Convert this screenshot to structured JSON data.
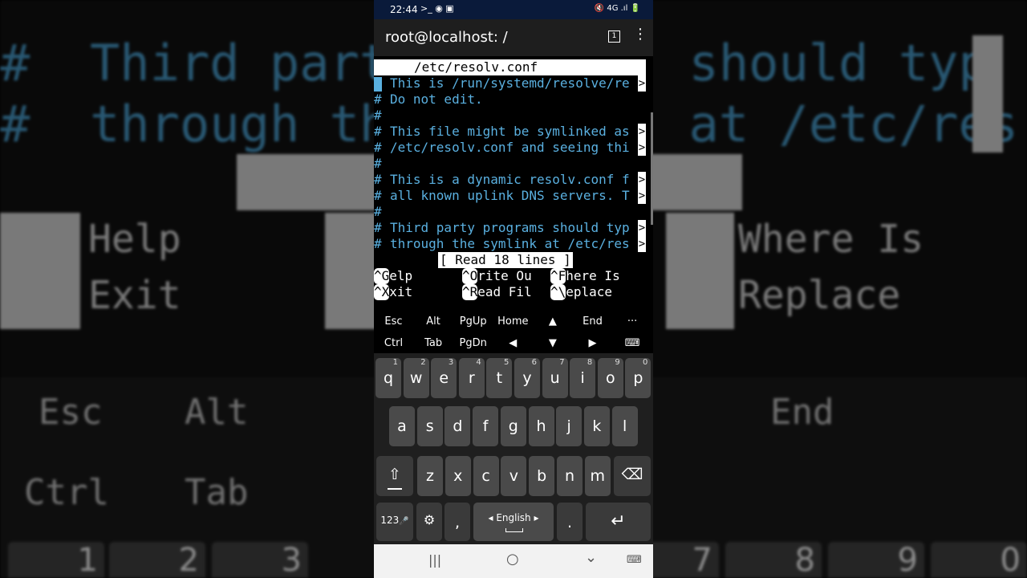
{
  "status_bar": {
    "time": "22:44",
    "left_icons": ">_ ◉ ▣",
    "right_icons": "🔇 4G .ıl 🔋"
  },
  "app_bar": {
    "title": "root@localhost: /",
    "window_count": "1",
    "menu_icon": "⋮"
  },
  "editor": {
    "file_title": "/etc/resolv.conf",
    "lines": [
      {
        "hash": "#",
        "text": "This is /run/systemd/resolve/re",
        "more": true
      },
      {
        "hash": "#",
        "text": "Do not edit.",
        "more": false
      },
      {
        "hash": "#",
        "text": "",
        "more": false
      },
      {
        "hash": "#",
        "text": "This file might be symlinked as",
        "more": true
      },
      {
        "hash": "#",
        "text": "/etc/resolv.conf and seeing thi",
        "more": true
      },
      {
        "hash": "#",
        "text": "",
        "more": false
      },
      {
        "hash": "#",
        "text": "This is a dynamic resolv.conf f",
        "more": true
      },
      {
        "hash": "#",
        "text": "all known uplink DNS servers. T",
        "more": true
      },
      {
        "hash": "#",
        "text": "",
        "more": false
      },
      {
        "hash": "#",
        "text": "Third party programs should typ",
        "more": true
      },
      {
        "hash": "#",
        "text": "through the symlink at /etc/res",
        "more": true
      }
    ],
    "more_marker": ">",
    "status_message": "[ Read 18 lines ]",
    "shortcuts": [
      {
        "key": "^G",
        "label": " Help"
      },
      {
        "key": "^O",
        "label": " Write Ou"
      },
      {
        "key": "^F",
        "label": " Where Is"
      },
      {
        "key": "^X",
        "label": " Exit"
      },
      {
        "key": "^R",
        "label": " Read Fil"
      },
      {
        "key": "^\\",
        "label": " Replace"
      }
    ]
  },
  "extra_keys": {
    "row1": [
      "Esc",
      "Alt",
      "PgUp",
      "Home",
      "▲",
      "End",
      "···"
    ],
    "row2": [
      "Ctrl",
      "Tab",
      "PgDn",
      "◀",
      "▼",
      "▶",
      "⌨"
    ]
  },
  "keyboard": {
    "row1": [
      {
        "c": "q",
        "n": "1"
      },
      {
        "c": "w",
        "n": "2"
      },
      {
        "c": "e",
        "n": "3"
      },
      {
        "c": "r",
        "n": "4"
      },
      {
        "c": "t",
        "n": "5"
      },
      {
        "c": "y",
        "n": "6"
      },
      {
        "c": "u",
        "n": "7"
      },
      {
        "c": "i",
        "n": "8"
      },
      {
        "c": "o",
        "n": "9"
      },
      {
        "c": "p",
        "n": "0"
      }
    ],
    "row2": [
      "a",
      "s",
      "d",
      "f",
      "g",
      "h",
      "j",
      "k",
      "l"
    ],
    "row3": [
      "z",
      "x",
      "c",
      "v",
      "b",
      "n",
      "m"
    ],
    "shift_icon": "⇧",
    "backspace_icon": "⌫",
    "symbols_label": "123",
    "mic_icon": "🎤",
    "settings_icon": "⚙",
    "comma": ",",
    "space_label": "◂ English ▸",
    "period": ".",
    "enter_icon": "↵"
  },
  "nav_bar": {
    "recents": "|||",
    "home": "○",
    "back": "⌄",
    "keyboard": "⌨"
  }
}
